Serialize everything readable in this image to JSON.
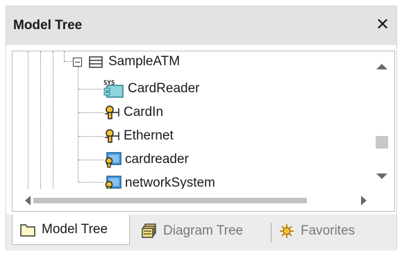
{
  "window": {
    "title": "Model Tree",
    "close_label": "✕"
  },
  "tree": {
    "root": {
      "label": "SampleATM",
      "icon": "package-icon"
    },
    "children": [
      {
        "label": "CardReader",
        "icon": "subsystem-component-icon",
        "badge": "SYS"
      },
      {
        "label": "CardIn",
        "icon": "port-icon"
      },
      {
        "label": "Ethernet",
        "icon": "port-icon"
      },
      {
        "label": "cardreader",
        "icon": "part-icon"
      },
      {
        "label": "networkSystem",
        "icon": "part-icon"
      }
    ]
  },
  "tabs": [
    {
      "label": "Model Tree",
      "icon": "folder-icon",
      "active": true
    },
    {
      "label": "Diagram Tree",
      "icon": "diagram-tree-icon",
      "active": false
    },
    {
      "label": "Favorites",
      "icon": "favorites-icon",
      "active": false
    }
  ],
  "colors": {
    "titlebar": "#e3e3e3",
    "port_gold": "#d4a017",
    "part_blue": "#3d8fd6",
    "tab_bar": "#ececec"
  }
}
